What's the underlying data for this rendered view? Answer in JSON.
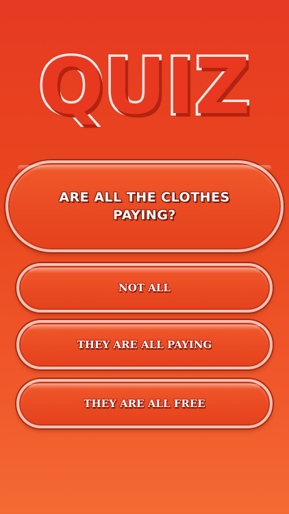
{
  "title": "QUIZ",
  "question": "ARE ALL THE CLOTHES PAYING?",
  "answers": [
    "NOT ALL",
    "THEY ARE ALL PAYING",
    "THEY ARE ALL FREE"
  ],
  "colors": {
    "background_top": "#e63a22",
    "background_bottom": "#f46a33",
    "pill_border": "#f7c4b5",
    "text": "#ffffff",
    "text_outline": "#7a1607"
  }
}
